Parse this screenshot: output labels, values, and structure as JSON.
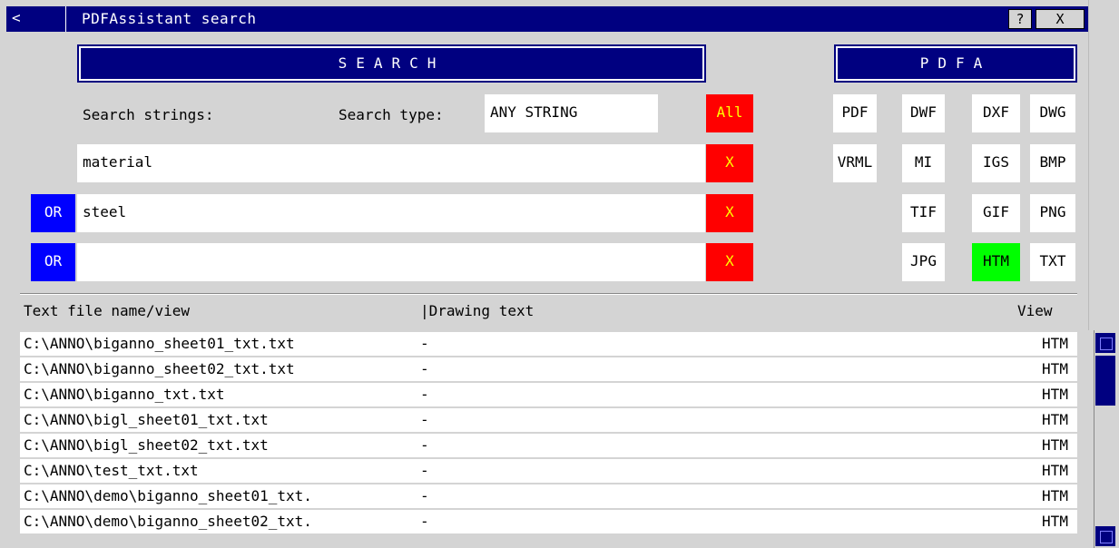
{
  "window": {
    "back_label": "<",
    "title": "PDFAssistant search",
    "help_label": "?",
    "close_label": "X"
  },
  "search_header": "SEARCH",
  "pdfa_header": "PDFA",
  "search": {
    "strings_label": "Search strings:",
    "type_label": "Search type:",
    "type_value": "ANY STRING",
    "all_label": "All",
    "rows": [
      {
        "connector": "",
        "value": "material",
        "remove": "X"
      },
      {
        "connector": "OR",
        "value": "steel",
        "remove": "X"
      },
      {
        "connector": "OR",
        "value": "",
        "remove": "X"
      }
    ]
  },
  "formats": {
    "pdf": "PDF",
    "dwf": "DWF",
    "dxf": "DXF",
    "dwg": "DWG",
    "vrml": "VRML",
    "mi": "MI",
    "igs": "IGS",
    "bmp": "BMP",
    "tif": "TIF",
    "gif": "GIF",
    "png": "PNG",
    "jpg": "JPG",
    "htm": "HTM",
    "txt": "TXT",
    "active": "HTM"
  },
  "results": {
    "col_file": "Text file name/view",
    "col_drawing": "|Drawing text",
    "col_view": "View",
    "rows": [
      {
        "file": "C:\\ANNO\\biganno_sheet01_txt.txt",
        "drawing": "-",
        "view": "HTM"
      },
      {
        "file": "C:\\ANNO\\biganno_sheet02_txt.txt",
        "drawing": "-",
        "view": "HTM"
      },
      {
        "file": "C:\\ANNO\\biganno_txt.txt",
        "drawing": "-",
        "view": "HTM"
      },
      {
        "file": "C:\\ANNO\\bigl_sheet01_txt.txt",
        "drawing": "-",
        "view": "HTM"
      },
      {
        "file": "C:\\ANNO\\bigl_sheet02_txt.txt",
        "drawing": "-",
        "view": "HTM"
      },
      {
        "file": "C:\\ANNO\\test_txt.txt",
        "drawing": "-",
        "view": "HTM"
      },
      {
        "file": "C:\\ANNO\\demo\\biganno_sheet01_txt.",
        "drawing": "-",
        "view": "HTM"
      },
      {
        "file": "C:\\ANNO\\demo\\biganno_sheet02_txt.",
        "drawing": "-",
        "view": "HTM"
      }
    ]
  },
  "colors": {
    "titlebar": "#000080",
    "remove_button": "#ff0000",
    "or_button": "#0000ff",
    "active_format": "#00ff00"
  }
}
